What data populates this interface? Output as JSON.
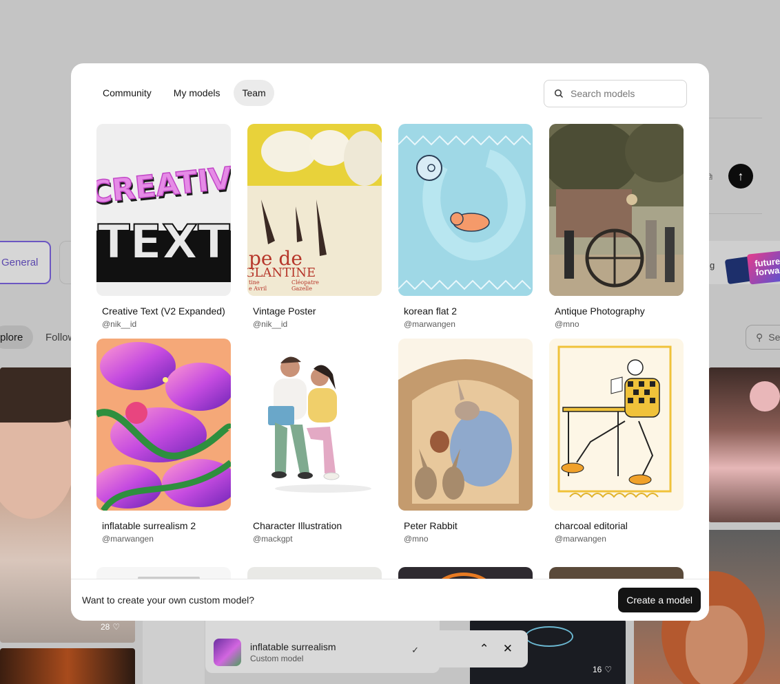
{
  "background": {
    "category_label": "General",
    "feed_tabs": [
      "plore",
      "Follow"
    ],
    "search_partial": "Se",
    "likes": [
      "28",
      "16"
    ],
    "right_card_text": "future forward",
    "selected_model": {
      "name": "inflatable surrealism",
      "type": "Custom model"
    }
  },
  "modal": {
    "tabs": [
      "Community",
      "My models",
      "Team"
    ],
    "active_tab": "Team",
    "search_placeholder": "Search models",
    "models": [
      {
        "title": "Creative Text (V2 Expanded)",
        "author": "@nik__id"
      },
      {
        "title": "Vintage Poster",
        "author": "@nik__id"
      },
      {
        "title": "korean flat 2",
        "author": "@marwangen"
      },
      {
        "title": "Antique Photography",
        "author": "@mno"
      },
      {
        "title": "inflatable surrealism 2",
        "author": "@marwangen"
      },
      {
        "title": "Character Illustration",
        "author": "@mackgpt"
      },
      {
        "title": "Peter Rabbit",
        "author": "@mno"
      },
      {
        "title": "charcoal editorial",
        "author": "@marwangen"
      }
    ],
    "thumb_text": {
      "creative": [
        "CREATIVE",
        "TEXT"
      ],
      "poster": [
        "pe de",
        "GLANTINE",
        "tine",
        "Cléopatre",
        "e Avril",
        "Gazelle"
      ]
    },
    "footer_question": "Want to create your own custom model?",
    "create_button": "Create a model"
  },
  "colors": {
    "accent": "#6b56c2",
    "primary_button": "#141414",
    "tab_active": "#ebebeb"
  }
}
